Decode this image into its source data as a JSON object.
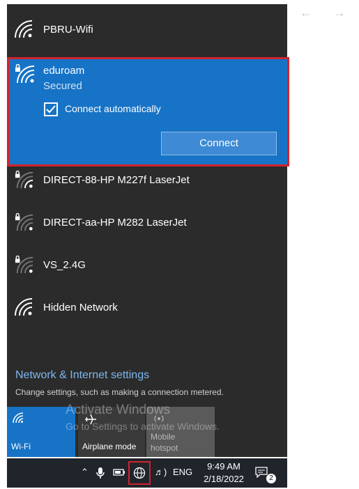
{
  "browser": {
    "back_icon": "arrow-left-icon",
    "forward_icon": "arrow-right-icon"
  },
  "networks": [
    {
      "name": "PBRU-Wifi",
      "secured": false
    },
    {
      "name": "DIRECT-88-HP M227f LaserJet",
      "secured": true
    },
    {
      "name": "DIRECT-aa-HP M282 LaserJet",
      "secured": true
    },
    {
      "name": "VS_2.4G",
      "secured": true
    },
    {
      "name": "Hidden Network",
      "secured": false
    }
  ],
  "selected_network": {
    "name": "eduroam",
    "status": "Secured",
    "connect_auto_label": "Connect automatically",
    "connect_auto_checked": true,
    "connect_button": "Connect"
  },
  "settings": {
    "link": "Network & Internet settings",
    "description": "Change settings, such as making a connection metered."
  },
  "quick_actions": {
    "wifi": "Wi-Fi",
    "airplane": "Airplane mode",
    "mobile_line1": "Mobile",
    "mobile_line2": "hotspot"
  },
  "watermark": {
    "line1": "Activate Windows",
    "line2": "Go to Settings to activate Windows."
  },
  "taskbar": {
    "language": "ENG",
    "time": "9:49 AM",
    "date": "2/18/2022",
    "notification_count": "2"
  },
  "colors": {
    "panel_bg": "#2b2b2b",
    "accent": "#1773c6",
    "highlight_border": "#d4222d",
    "link": "#7fb7f0"
  }
}
